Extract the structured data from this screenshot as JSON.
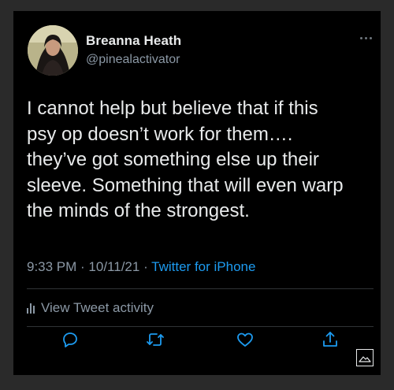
{
  "user": {
    "display_name": "Breanna Heath",
    "handle": "@pinealactivator"
  },
  "tweet": {
    "lines": [
      "I cannot help but believe that if this",
      "psy op doesn’t work for them….",
      "they’ve got something else up their",
      "sleeve. Something that will even warp",
      "the minds of the strongest."
    ],
    "time": "9:33 PM",
    "separator1": " · ",
    "date": "10/11/21",
    "separator2": " · ",
    "source": "Twitter for iPhone"
  },
  "activity": {
    "label": "View Tweet activity"
  },
  "actions": [
    "reply-icon",
    "retweet-icon",
    "like-icon",
    "share-icon"
  ],
  "colors": {
    "background": "#000000",
    "text": "#e8eaeb",
    "secondary": "#8b98a5",
    "accent": "#1d9bf0",
    "divider": "#2f3336"
  }
}
